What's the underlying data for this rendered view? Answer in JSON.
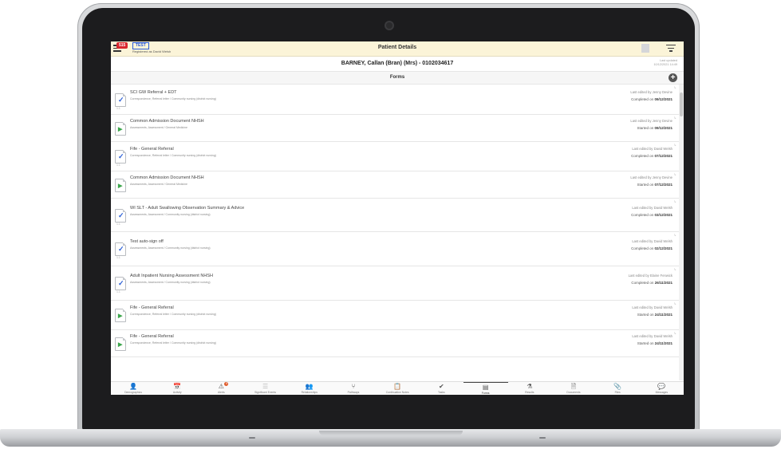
{
  "header": {
    "alert_count": "515",
    "test_badge": "TEST",
    "registered_as": "Registered as David Welsh",
    "title": "Patient Details"
  },
  "patient": {
    "name": "BARNEY, Callan (Bran) (Mrs) - 0102034617",
    "last_updated_label": "Last updated",
    "last_updated_value": "10/12/2021 14:49"
  },
  "forms": {
    "title": "Forms",
    "items": [
      {
        "title": "SCI GW Referral + EDT",
        "subtitle": "Correspondence, Referral letter / Community nursing (district nursing)",
        "edited": "Last edited by Jenny Devine",
        "status_prefix": "Completed on",
        "status_date": "09/12/2021",
        "icon": "check",
        "version": "1.1"
      },
      {
        "title": "Common Admission Document NHSH",
        "subtitle": "Assessments, Assessment / General Medicine",
        "edited": "Last edited by Jenny Devine",
        "status_prefix": "Started on",
        "status_date": "09/12/2021",
        "icon": "play",
        "version": ""
      },
      {
        "title": "Fife - General Referral",
        "subtitle": "Correspondence, Referral letter / Community nursing (district nursing)",
        "edited": "Last edited by David Welsh",
        "status_prefix": "Completed on",
        "status_date": "07/12/2021",
        "icon": "check",
        "version": "1.1"
      },
      {
        "title": "Common Admission Document NHSH",
        "subtitle": "Assessments, Assessment / General Medicine",
        "edited": "Last edited by Jenny Devine",
        "status_prefix": "Started on",
        "status_date": "07/12/2021",
        "icon": "play",
        "version": ""
      },
      {
        "title": "WI SLT - Adult Swallowing Observation Summary & Advice",
        "subtitle": "Assessments, Assessment / Community nursing (district nursing)",
        "edited": "Last edited by David Welsh",
        "status_prefix": "Completed on",
        "status_date": "03/12/2021",
        "icon": "check",
        "version": "1.1"
      },
      {
        "title": "Test auto-sign off",
        "subtitle": "Assessments, Assessment / Community nursing (district nursing)",
        "edited": "Last edited by David Welsh",
        "status_prefix": "Completed on",
        "status_date": "02/12/2021",
        "icon": "check",
        "version": "1.1"
      },
      {
        "title": "Adult Inpatient Nursing Assessment NHSH",
        "subtitle": "Assessments, Assessment / Community nursing (district nursing)",
        "edited": "Last edited by Elaine Fenwick",
        "status_prefix": "Completed on",
        "status_date": "26/11/2021",
        "icon": "check",
        "version": "1.1"
      },
      {
        "title": "Fife - General Referral",
        "subtitle": "Correspondence, Referral letter / Community nursing (district nursing)",
        "edited": "Last edited by David Welsh",
        "status_prefix": "Started on",
        "status_date": "24/11/2021",
        "icon": "play",
        "version": ""
      },
      {
        "title": "Fife - General Referral",
        "subtitle": "Correspondence, Referral letter / Community nursing (district nursing)",
        "edited": "Last edited by David Welsh",
        "status_prefix": "Started on",
        "status_date": "24/11/2021",
        "icon": "play",
        "version": ""
      }
    ]
  },
  "tabs": [
    {
      "label": "Demographics",
      "icon": "person-icon",
      "glyph": "👤"
    },
    {
      "label": "Activity",
      "icon": "calendar-icon",
      "glyph": "📅"
    },
    {
      "label": "Alerts",
      "icon": "warning-icon",
      "glyph": "⚠",
      "badge": "9"
    },
    {
      "label": "Significant Events",
      "icon": "list-icon",
      "glyph": "☰"
    },
    {
      "label": "Relationships",
      "icon": "people-icon",
      "glyph": "👥"
    },
    {
      "label": "Pathways",
      "icon": "pathway-icon",
      "glyph": "⑂"
    },
    {
      "label": "Continuation Notes",
      "icon": "clipboard-icon",
      "glyph": "📋"
    },
    {
      "label": "Tasks",
      "icon": "task-check-icon",
      "glyph": "✔"
    },
    {
      "label": "Forms",
      "icon": "forms-icon",
      "glyph": "▤"
    },
    {
      "label": "Results",
      "icon": "flask-icon",
      "glyph": "⚗"
    },
    {
      "label": "Documents",
      "icon": "document-icon",
      "glyph": "🗎"
    },
    {
      "label": "Files",
      "icon": "paperclip-icon",
      "glyph": "📎"
    },
    {
      "label": "Messages",
      "icon": "chat-icon",
      "glyph": "💬"
    }
  ],
  "active_tab": "Forms",
  "colors": {
    "header_bg": "#fbf4d8",
    "alert_red": "#d9272e",
    "test_blue": "#2a5bd7",
    "check_blue": "#2b5fd6",
    "play_green": "#3aa54a"
  }
}
